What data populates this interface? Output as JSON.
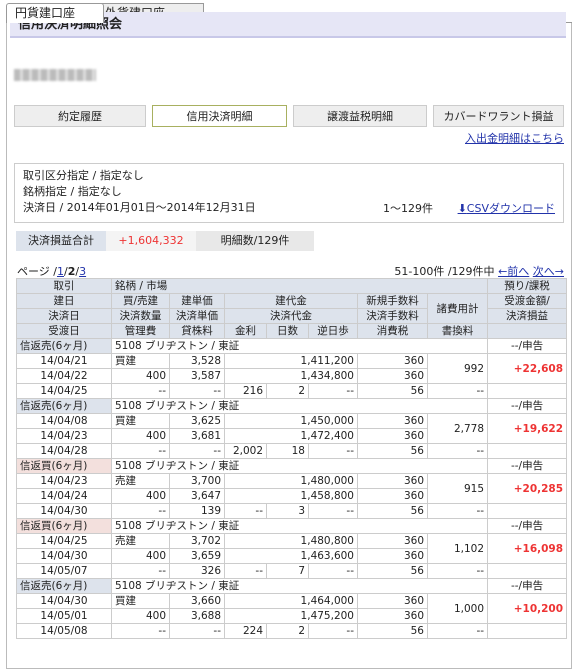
{
  "tabs": [
    {
      "label": "円貨建口座"
    },
    {
      "label": "外貨建口座"
    }
  ],
  "page_title": "信用決済明細照会",
  "subtabs": [
    {
      "label": "約定履歴"
    },
    {
      "label": "信用決済明細"
    },
    {
      "label": "譲渡益税明細"
    },
    {
      "label": "カバードワラント損益"
    }
  ],
  "deposit_link": "入出金明細はこちら",
  "filter": {
    "line1": "取引区分指定 / 指定なし",
    "line2": "銘柄指定 /  指定なし",
    "line3": "決済日 / 2014年01月01日〜2014年12月31日",
    "count": "1〜129件",
    "csv": "CSVダウンロード"
  },
  "summary": {
    "label": "決済損益合計",
    "value": "+1,604,332",
    "count": "明細数/129件"
  },
  "pager": {
    "prefix": "ページ /",
    "p1": "1",
    "sep": "/",
    "p2": "2",
    "sep2": "/",
    "p3": "3",
    "range": "51-100件 /129件中",
    "prev": "←前へ",
    "next": "次へ→"
  },
  "headers": {
    "h1": [
      "取引",
      "銘柄 / 市場",
      "預り/課税"
    ],
    "h2": [
      "建日",
      "買/売建",
      "建単価",
      "建代金",
      "新規手数料",
      "諸費用計",
      "受渡金額/"
    ],
    "h3": [
      "決済日",
      "決済数量",
      "決済単価",
      "決済代金",
      "決済手数料",
      "決済損益"
    ],
    "h4": [
      "受渡日",
      "管理費",
      "貸株料",
      "金利",
      "日数",
      "逆日歩",
      "消費税",
      "書換料"
    ]
  },
  "rows": [
    {
      "type": "信返売(6ヶ月)",
      "sell": false,
      "name": "5108 ブリヂストン / 東証",
      "tax": "--/申告",
      "d1": "14/04/21",
      "d2": "14/04/22",
      "d3": "14/04/25",
      "side": "買建",
      "qty": "400",
      "mgmt": "--",
      "p1": "3,528",
      "p2": "3,587",
      "lend": "--",
      "interest": "216",
      "days": "2",
      "rev": "--",
      "v1": "1,411,200",
      "v2": "1,434,800",
      "f1": "360",
      "f2": "360",
      "ctax": "56",
      "cost": "992",
      "rw": "--",
      "pl": "+22,608"
    },
    {
      "type": "信返売(6ヶ月)",
      "sell": false,
      "name": "5108 ブリヂストン / 東証",
      "tax": "--/申告",
      "d1": "14/04/08",
      "d2": "14/04/23",
      "d3": "14/04/28",
      "side": "買建",
      "qty": "400",
      "mgmt": "--",
      "p1": "3,625",
      "p2": "3,681",
      "lend": "--",
      "interest": "2,002",
      "days": "18",
      "rev": "--",
      "v1": "1,450,000",
      "v2": "1,472,400",
      "f1": "360",
      "f2": "360",
      "ctax": "56",
      "cost": "2,778",
      "rw": "--",
      "pl": "+19,622"
    },
    {
      "type": "信返買(6ヶ月)",
      "sell": true,
      "name": "5108 ブリヂストン / 東証",
      "tax": "--/申告",
      "d1": "14/04/23",
      "d2": "14/04/24",
      "d3": "14/04/30",
      "side": "売建",
      "qty": "400",
      "mgmt": "--",
      "p1": "3,700",
      "p2": "3,647",
      "lend": "139",
      "interest": "--",
      "days": "3",
      "rev": "--",
      "v1": "1,480,000",
      "v2": "1,458,800",
      "f1": "360",
      "f2": "360",
      "ctax": "56",
      "cost": "915",
      "rw": "--",
      "pl": "+20,285"
    },
    {
      "type": "信返買(6ヶ月)",
      "sell": true,
      "name": "5108 ブリヂストン / 東証",
      "tax": "--/申告",
      "d1": "14/04/25",
      "d2": "14/04/30",
      "d3": "14/05/07",
      "side": "売建",
      "qty": "400",
      "mgmt": "--",
      "p1": "3,702",
      "p2": "3,659",
      "lend": "326",
      "interest": "--",
      "days": "7",
      "rev": "--",
      "v1": "1,480,800",
      "v2": "1,463,600",
      "f1": "360",
      "f2": "360",
      "ctax": "56",
      "cost": "1,102",
      "rw": "--",
      "pl": "+16,098"
    },
    {
      "type": "信返売(6ヶ月)",
      "sell": false,
      "name": "5108 ブリヂストン / 東証",
      "tax": "--/申告",
      "d1": "14/04/30",
      "d2": "14/05/01",
      "d3": "14/05/08",
      "side": "買建",
      "qty": "400",
      "mgmt": "--",
      "p1": "3,660",
      "p2": "3,688",
      "lend": "--",
      "interest": "224",
      "days": "2",
      "rev": "--",
      "v1": "1,464,000",
      "v2": "1,475,200",
      "f1": "360",
      "f2": "360",
      "ctax": "56",
      "cost": "1,000",
      "rw": "--",
      "pl": "+10,200"
    }
  ]
}
